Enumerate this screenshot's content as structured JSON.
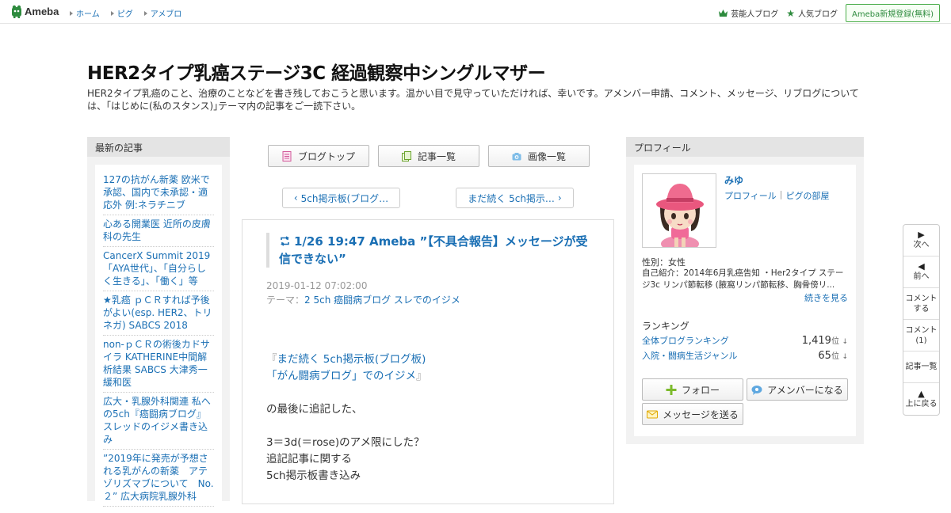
{
  "topbar": {
    "logo_text": "Ameba",
    "nav": [
      "ホーム",
      "ピグ",
      "アメブロ"
    ],
    "celebrity_blog": "芸能人ブログ",
    "popular_blog": "人気ブログ",
    "signup": "Ameba新規登録(無料)",
    "icons": {
      "logo": "ameba-logo-icon",
      "celebrity": "crown-icon",
      "popular": "star-icon"
    },
    "accent": "#2e8b3e"
  },
  "header": {
    "title": "HER2タイプ乳癌ステージ3C 経過観察中シングルマザー",
    "description": "HER2タイプ乳癌のこと、治療のことなどを書き残しておこうと思います。温かい目で見守っていただければ、幸いです。アメンバー申請、コメント、メッセージ、リブログについては、｢はじめに(私のスタンス)｣テーマ内の記事をご一読下さい。"
  },
  "left_sidebar": {
    "heading": "最新の記事",
    "items": [
      "127の抗がん新薬 欧米で承認、国内で未承認・適応外 例:ネラチニブ",
      "心ある開業医 近所の皮膚科の先生",
      "CancerX Summit 2019 「AYA世代」、「自分らしく生きる」、「働く」等",
      "★乳癌 ｐＣＲすれば予後がよい(esp. HER2、トリネガ) SABCS 2018",
      "non-ｐＣＲの術後カドサイラ KATHERINE中間解析結果 SABCS 大津秀一緩和医",
      "広大・乳腺外科関連 私への5ch『癌闘病ブログ』スレッドのイジメ書き込み",
      "”2019年に発売が予想される乳がんの新薬　アテゾリズマブについて　No.２” 広大病院乳腺外科"
    ]
  },
  "tabs": [
    {
      "label": "ブログトップ",
      "icon": "document-icon"
    },
    {
      "label": "記事一覧",
      "icon": "list-icon"
    },
    {
      "label": "画像一覧",
      "icon": "camera-icon"
    }
  ],
  "pager": {
    "prev": "5ch掲示板(ブログ…",
    "next": "まだ続く 5ch掲示…"
  },
  "entry": {
    "title": "1/26 19:47 Ameba ”【不具合報告】メッセージが受信できない”",
    "date": "2019-01-12 07:02:00",
    "theme_label": "テーマ：",
    "theme": "2 5ch 癌闘病ブログ スレでのイジメ",
    "quote_open": "『",
    "quote_line1": "まだ続く 5ch掲示板(ブログ板)",
    "quote_line2": "「がん闘病ブログ」でのイジメ",
    "quote_close": "』",
    "para1": "の最後に追記した、",
    "line1": "3＝3d(＝rose)のアメ限にした？",
    "line2": "追記記事に関する",
    "line3": "5ch掲示板書き込み"
  },
  "profile": {
    "heading": "プロフィール",
    "name": "みゆ",
    "link_profile": "プロフィール",
    "link_sep": "|",
    "link_room": "ピグの部屋",
    "gender": "性別：女性",
    "intro": "自己紹介：2014年6月乳癌告知 ・Her2タイプ ステージ3c リンパ節転移 (腋窩リンパ節転移、胸骨傍リ...",
    "read_more": "続きを見る",
    "ranking_heading": "ランキング",
    "rankings": [
      {
        "name": "全体ブログランキング",
        "value": "1,419",
        "unit": "位",
        "trend": "↓"
      },
      {
        "name": "入院・闘病生活ジャンル",
        "value": "65",
        "unit": "位",
        "trend": "↓"
      }
    ],
    "follow": "フォロー",
    "amember": "アメンバーになる",
    "message": "メッセージを送る"
  },
  "float_nav": {
    "next": "次へ",
    "prev": "前へ",
    "comment_line1": "コメント",
    "comment_line2": "する",
    "comments_line1": "コメント",
    "comments_line2": "(1)",
    "list": "記事一覧",
    "top": "上に戻る"
  }
}
